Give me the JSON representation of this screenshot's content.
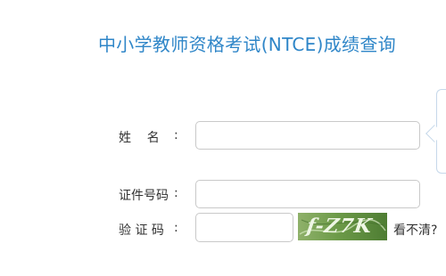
{
  "page": {
    "title": "中小学教师资格考试(NTCE)成绩查询"
  },
  "form": {
    "name_label": "姓    名",
    "id_label": "证件号码",
    "captcha_label": "验 证 码",
    "colon": ":",
    "name_value": "",
    "id_value": "",
    "captcha_value": "",
    "captcha_image_text": "f-Z7K",
    "refresh_label": "看不清?"
  },
  "colors": {
    "title": "#2f86c8",
    "input_border": "#c9c9c9",
    "captcha_bg": "#6c9a48",
    "tooltip_border": "#c6d8ea"
  }
}
